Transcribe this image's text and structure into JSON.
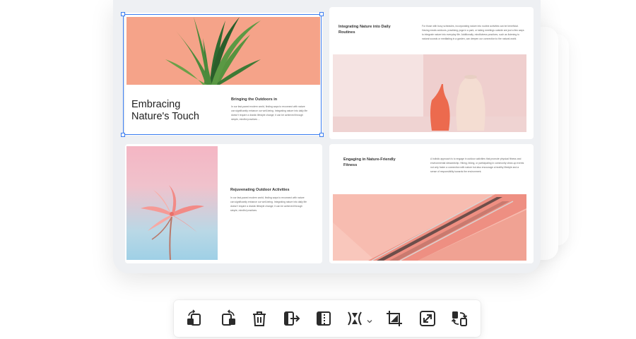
{
  "pages": {
    "p1": {
      "title": "Embracing\nNature's Touch",
      "subtitle": "Bringing the Outdoors in",
      "body": "In our fast-paced modern world, finding ways to reconnect with nature can significantly enhance our well-being. Integrating nature into daily life doesn't require a drastic lifestyle change; it can be achieved through simple, mindful practices ..."
    },
    "p2": {
      "subtitle": "Integrating Nature into Daily Routines",
      "body": "For those with busy schedules, incorporating nature into routine activities can be beneficial. Having meals outdoors, practicing yoga in a park, or taking meetings outside are just a few ways to integrate nature into everyday life. Additionally, mindfulness practices, such as listening to natural sounds or meditating in a garden, can deepen our connection to the natural world."
    },
    "p3": {
      "subtitle": "Rejuvenating Outdoor Activities",
      "body": "In our fast-paced modern world, finding ways to reconnect with nature can significantly enhance our well-being. Integrating nature into daily life doesn't require a drastic lifestyle change; it can be achieved through simple, mindful practices."
    },
    "p4": {
      "subtitle": "Engaging in Nature-Friendly Fitness",
      "body": "A holistic approach is to engage in outdoor activities that promote physical fitness and environmental stewardship. Hiking, biking, or participating in community clean-up events not only foster a connection with nature but also encourage a healthy lifestyle and a sense of responsibility towards the environment."
    }
  },
  "toolbar": {
    "tools": [
      {
        "icon": "rotate-left-icon"
      },
      {
        "icon": "rotate-right-icon"
      },
      {
        "icon": "trash-icon"
      },
      {
        "icon": "extract-page-icon"
      },
      {
        "icon": "split-page-icon"
      },
      {
        "icon": "insert-page-icon"
      },
      {
        "icon": "crop-icon"
      },
      {
        "icon": "resize-icon"
      },
      {
        "icon": "replace-page-icon"
      }
    ]
  },
  "colors": {
    "selection": "#3b7df0",
    "icon": "#2b2b2b",
    "accent_coral": "#f5a389"
  }
}
